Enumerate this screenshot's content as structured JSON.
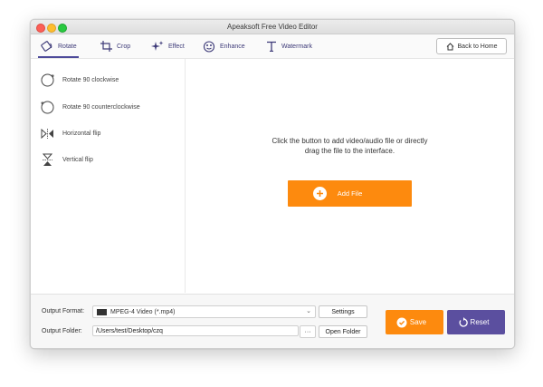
{
  "window": {
    "title": "Apeaksoft Free Video Editor"
  },
  "toolbar": {
    "tabs": [
      {
        "label": "Rotate",
        "icon": "rotate-icon",
        "active": true
      },
      {
        "label": "Crop",
        "icon": "crop-icon",
        "active": false
      },
      {
        "label": "Effect",
        "icon": "effect-icon",
        "active": false
      },
      {
        "label": "Enhance",
        "icon": "enhance-icon",
        "active": false
      },
      {
        "label": "Watermark",
        "icon": "watermark-icon",
        "active": false
      }
    ],
    "back_label": "Back to Home"
  },
  "sidebar": {
    "items": [
      {
        "label": "Rotate 90 clockwise",
        "icon": "rotate-cw-icon",
        "icon_text": "90"
      },
      {
        "label": "Rotate 90 counterclockwise",
        "icon": "rotate-ccw-icon",
        "icon_text": "90"
      },
      {
        "label": "Horizontal flip",
        "icon": "horizontal-flip-icon"
      },
      {
        "label": "Vertical flip",
        "icon": "vertical-flip-icon"
      }
    ]
  },
  "main": {
    "message_line1": "Click the button to add video/audio file or directly",
    "message_line2": "drag the file to the interface.",
    "add_file_label": "Add File"
  },
  "bottom": {
    "output_format_label": "Output Format:",
    "output_format_value": "MPEG-4 Video (*.mp4)",
    "settings_label": "Settings",
    "output_folder_label": "Output Folder:",
    "output_folder_value": "/Users/test/Desktop/czq",
    "browse_label": "···",
    "open_folder_label": "Open Folder",
    "save_label": "Save",
    "reset_label": "Reset"
  },
  "colors": {
    "accent_purple": "#4d4a9a",
    "save_orange": "#fd8a0e",
    "add_file_orange": "#fd8a0e",
    "reset_purple": "#5b4f9f"
  }
}
